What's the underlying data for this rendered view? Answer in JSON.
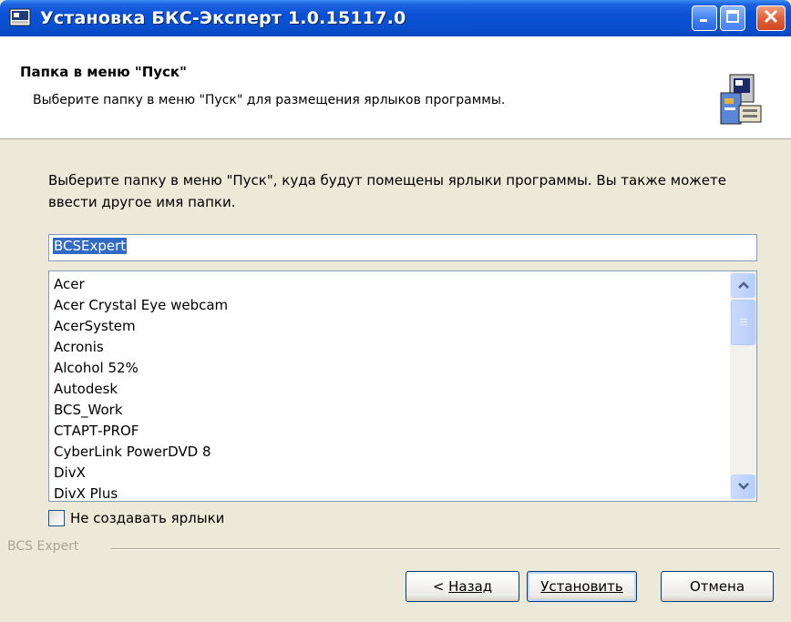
{
  "window": {
    "title": "Установка БКС-Эксперт 1.0.15117.0"
  },
  "header": {
    "title": "Папка в меню \"Пуск\"",
    "subtitle": "Выберите папку в меню \"Пуск\" для размещения ярлыков программы."
  },
  "body": {
    "description": "Выберите папку в меню \"Пуск\", куда будут помещены ярлыки программы. Вы также можете ввести другое имя папки.",
    "folder_value": "BCSExpert",
    "folders": [
      "Acer",
      "Acer Crystal Eye webcam",
      "AcerSystem",
      "Acronis",
      "Alcohol 52%",
      "Autodesk",
      "BCS_Work",
      "СТАРТ-PROF",
      "CyberLink PowerDVD 8",
      "DivX",
      "DivX Plus"
    ],
    "no_shortcuts_label": "Не создавать ярлыки",
    "no_shortcuts_checked": false
  },
  "footer": {
    "brand": "BCS Expert",
    "back_label_prefix": "< ",
    "back_label": "Назад",
    "install_label": "Установить",
    "cancel_label": "Отмена"
  },
  "icons": {
    "app": "installer-icon",
    "header": "computer-install-icon",
    "minimize": "minimize-icon",
    "maximize": "maximize-icon",
    "close": "close-icon"
  },
  "colors": {
    "titlebar": "#0a4fd6",
    "selection": "#316ac5",
    "dialog_bg": "#ece9d8"
  }
}
